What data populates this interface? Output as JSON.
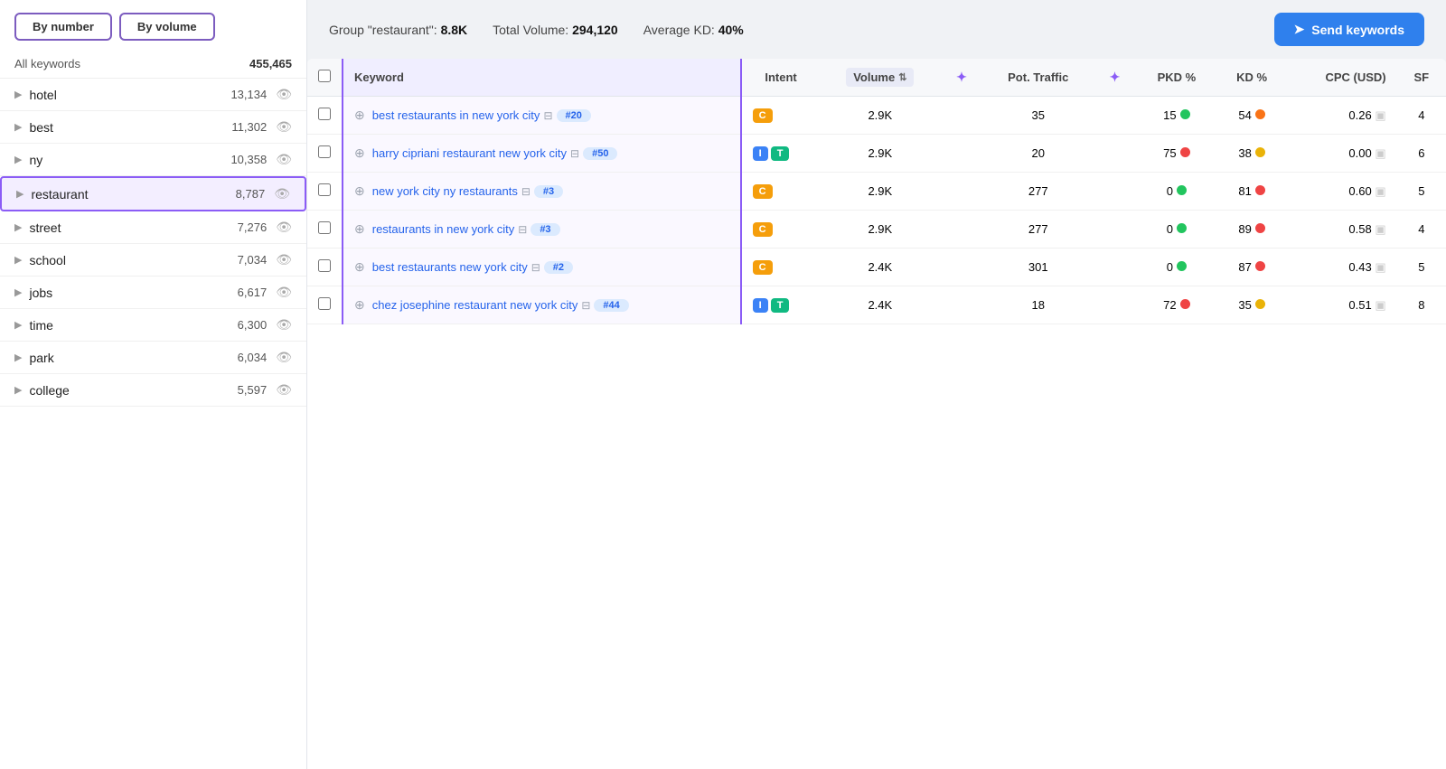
{
  "sidebar": {
    "toggle": {
      "by_number": "By number",
      "by_volume": "By volume"
    },
    "all_keywords": {
      "label": "All keywords",
      "count": "455,465"
    },
    "items": [
      {
        "id": "hotel",
        "label": "hotel",
        "count": "13,134"
      },
      {
        "id": "best",
        "label": "best",
        "count": "11,302"
      },
      {
        "id": "ny",
        "label": "ny",
        "count": "10,358"
      },
      {
        "id": "restaurant",
        "label": "restaurant",
        "count": "8,787",
        "active": true
      },
      {
        "id": "street",
        "label": "street",
        "count": "7,276"
      },
      {
        "id": "school",
        "label": "school",
        "count": "7,034"
      },
      {
        "id": "jobs",
        "label": "jobs",
        "count": "6,617"
      },
      {
        "id": "time",
        "label": "time",
        "count": "6,300"
      },
      {
        "id": "park",
        "label": "park",
        "count": "6,034"
      },
      {
        "id": "college",
        "label": "college",
        "count": "5,597"
      }
    ]
  },
  "topbar": {
    "group_label": "Group \"restaurant\":",
    "group_count": "8.8K",
    "total_volume_label": "Total Volume:",
    "total_volume": "294,120",
    "avg_kd_label": "Average KD:",
    "avg_kd": "40%",
    "send_btn": "Send keywords"
  },
  "table": {
    "columns": {
      "keyword": "Keyword",
      "intent": "Intent",
      "volume": "Volume",
      "pot_traffic": "Pot. Traffic",
      "pkd": "PKD %",
      "kd": "KD %",
      "cpc": "CPC (USD)",
      "sf": "SF"
    },
    "rows": [
      {
        "keyword": "best restaurants in new york city",
        "badge": "#20",
        "intent": [
          "C"
        ],
        "volume": "2.9K",
        "pot_traffic": "35",
        "pkd": "15",
        "pkd_dot": "green",
        "kd": "54",
        "kd_dot": "orange",
        "cpc": "0.26",
        "sf": "4"
      },
      {
        "keyword": "harry cipriani restaurant new york city",
        "badge": "#50",
        "intent": [
          "I",
          "T"
        ],
        "volume": "2.9K",
        "pot_traffic": "20",
        "pkd": "75",
        "pkd_dot": "red",
        "kd": "38",
        "kd_dot": "yellow",
        "cpc": "0.00",
        "sf": "6"
      },
      {
        "keyword": "new york city ny restaurants",
        "badge": "#3",
        "intent": [
          "C"
        ],
        "volume": "2.9K",
        "pot_traffic": "277",
        "pkd": "0",
        "pkd_dot": "green",
        "kd": "81",
        "kd_dot": "red",
        "cpc": "0.60",
        "sf": "5"
      },
      {
        "keyword": "restaurants in new york city",
        "badge": "#3",
        "intent": [
          "C"
        ],
        "volume": "2.9K",
        "pot_traffic": "277",
        "pkd": "0",
        "pkd_dot": "green",
        "kd": "89",
        "kd_dot": "red",
        "cpc": "0.58",
        "sf": "4"
      },
      {
        "keyword": "best restaurants new york city",
        "badge": "#2",
        "intent": [
          "C"
        ],
        "volume": "2.4K",
        "pot_traffic": "301",
        "pkd": "0",
        "pkd_dot": "green",
        "kd": "87",
        "kd_dot": "red",
        "cpc": "0.43",
        "sf": "5"
      },
      {
        "keyword": "chez josephine restaurant new york city",
        "badge": "#44",
        "intent": [
          "I",
          "T"
        ],
        "volume": "2.4K",
        "pot_traffic": "18",
        "pkd": "72",
        "pkd_dot": "red",
        "kd": "35",
        "kd_dot": "yellow",
        "cpc": "0.51",
        "sf": "8"
      }
    ]
  }
}
